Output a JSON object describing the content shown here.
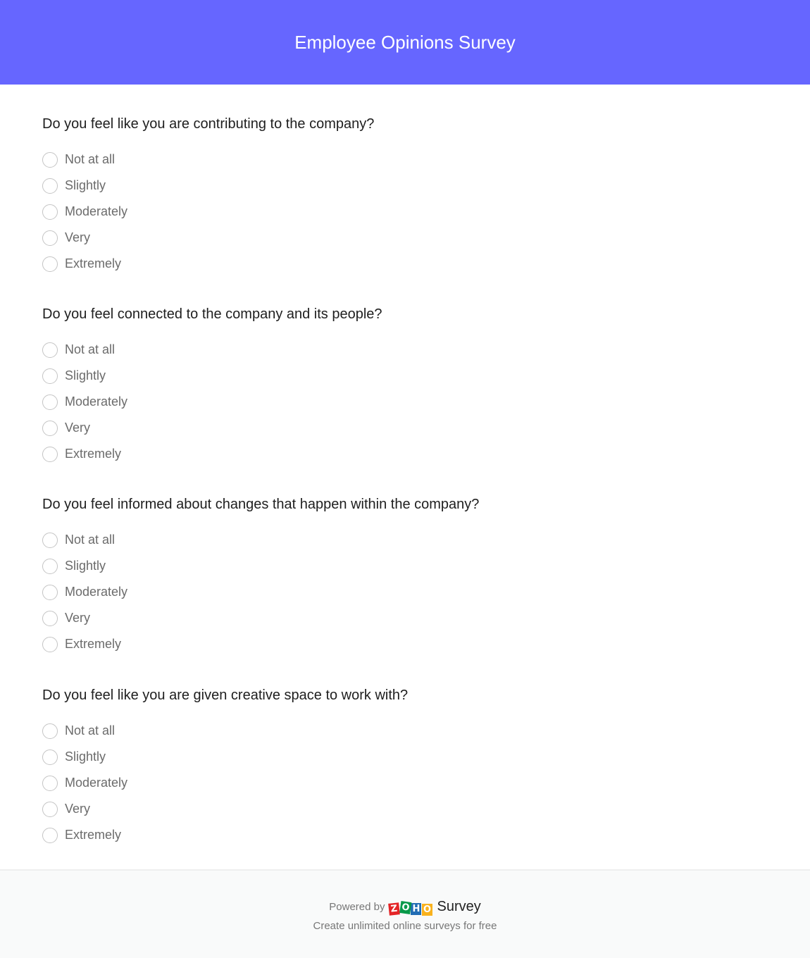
{
  "header": {
    "title": "Employee Opinions Survey",
    "background_color": "#6666ff"
  },
  "questions": [
    {
      "text": "Do you feel like you are contributing to the company?",
      "options": [
        "Not at all",
        "Slightly",
        "Moderately",
        "Very",
        "Extremely"
      ]
    },
    {
      "text": "Do you feel connected to the company and its people?",
      "options": [
        "Not at all",
        "Slightly",
        "Moderately",
        "Very",
        "Extremely"
      ]
    },
    {
      "text": "Do you feel informed about changes that happen within the company?",
      "options": [
        "Not at all",
        "Slightly",
        "Moderately",
        "Very",
        "Extremely"
      ]
    },
    {
      "text": "Do you feel like you are given creative space to work with?",
      "options": [
        "Not at all",
        "Slightly",
        "Moderately",
        "Very",
        "Extremely"
      ]
    }
  ],
  "footer": {
    "powered_by": "Powered by",
    "logo_letters": [
      "Z",
      "O",
      "H",
      "O"
    ],
    "brand": "Survey",
    "tagline": "Create unlimited online surveys for free",
    "logo_colors": [
      "#e42527",
      "#089949",
      "#226db4",
      "#f9b21d"
    ]
  }
}
